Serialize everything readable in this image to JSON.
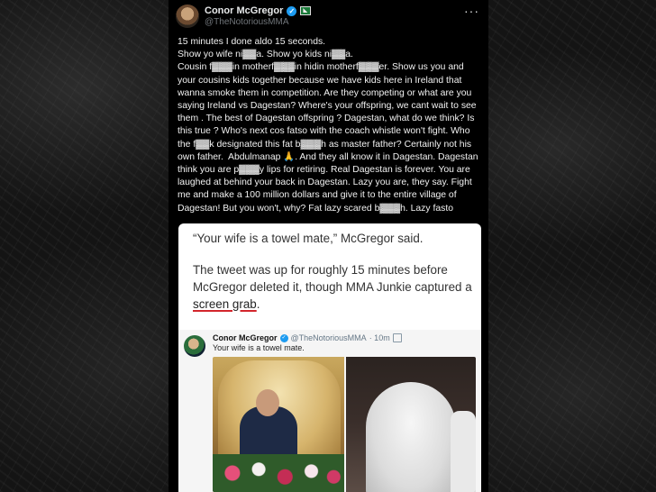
{
  "tweet": {
    "name": "Conor McGregor",
    "handle": "@TheNotoriousMMA",
    "text": "15 minutes I done aldo 15 seconds.\nShow yo wife ni▓▓a. Show yo kids ni▓▓a.\nCousin f▓▓▓in motherf▓▓▓in hidin motherf▓▓▓er. Show us you and your cousins kids together because we have kids here in Ireland that wanna smoke them in competition. Are they competing or what are you saying Ireland vs Dagestan? Where's your offspring, we cant wait to see them . The best of Dagestan offspring ? Dagestan, what do we think? Is this true ? Who's next cos fatso with the coach whistle won't fight. Who the f▓▓k designated this fat b▓▓▓h as master father? Certainly not his own father.  Abdulmanap 🙏. And they all know it in Dagestan. Dagestan think you are p▓▓▓y lips for retiring. Real Dagestan is forever. You are laughed at behind your back in Dagestan. Lazy you are, they say. Fight me and make a 100 million dollars and give it to the entire village of Dagestan! But you won't, why? Fat lazy scared b▓▓▓h. Lazy fasto"
  },
  "article": {
    "quote": "“Your wife is a towel mate,” McGregor said.",
    "para_before": "The tweet was up for roughly 15 minutes before McGregor deleted it, though MMA Junkie captured a ",
    "link_text": "screen grab",
    "para_after": "."
  },
  "embed": {
    "name": "Conor McGregor",
    "handle": "@TheNotoriousMMA",
    "time": "· 10m",
    "text": "Your wife is a towel mate."
  },
  "colors": {
    "verified_blue": "#1d9bf0",
    "link_underline": "#d3262c"
  },
  "icons": [
    "verified-badge-icon",
    "ireland-flag-icon",
    "more-options-icon",
    "calendar-icon"
  ]
}
